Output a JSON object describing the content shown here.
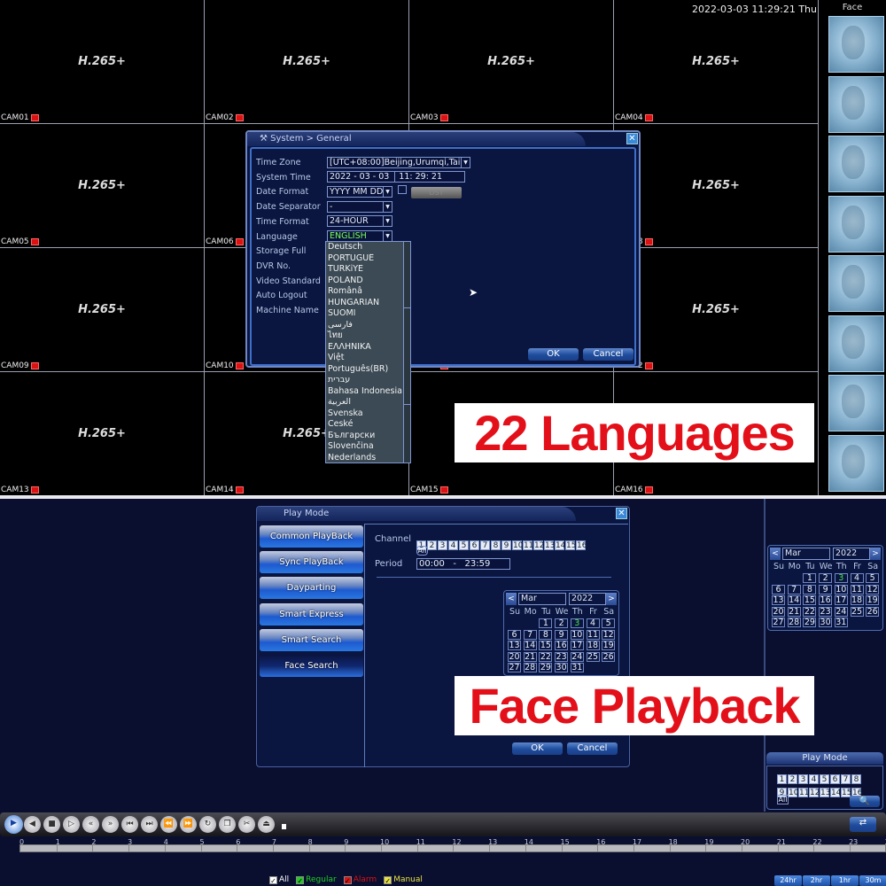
{
  "live": {
    "datetime": "2022-03-03 11:29:21 Thu",
    "codec": "H.265+",
    "cameras": [
      "CAM01",
      "CAM02",
      "CAM03",
      "CAM04",
      "CAM05",
      "CAM06",
      "CAM07",
      "CAM08",
      "CAM09",
      "CAM10",
      "CAM11",
      "CAM12",
      "CAM13",
      "CAM14",
      "CAM15",
      "CAM16"
    ],
    "face_panel_title": "Face",
    "face_count": 8
  },
  "general_dialog": {
    "title": "System > General",
    "close": "✕",
    "labels": [
      "Time Zone",
      "System Time",
      "Date Format",
      "Date Separator",
      "Time Format",
      "Language",
      "Storage Full",
      "DVR No.",
      "Video Standard",
      "Auto Logout",
      "Machine Name"
    ],
    "time_zone": "[UTC+08:00]Beijing,Urumqi,Tai",
    "system_date": "2022 - 03 - 03",
    "system_time": "11: 29: 21",
    "date_format": "YYYY MM DD",
    "dst_label": "DST",
    "date_separator": "-",
    "time_format": "24-HOUR",
    "language": "ENGLISH",
    "language_color": "#7dff5a",
    "ok": "OK",
    "cancel": "Cancel",
    "language_options": [
      "Deutsch",
      "PORTUGUÊ",
      "TÜRKiYE",
      "POLAND",
      "Românâ",
      "HUNGARIAN",
      "SUOMI",
      "فارسی",
      "ไทย",
      "ΕΛΛΗΝΙΚΑ",
      "Việt",
      "Português(BR)",
      "עברית",
      "Bahasa Indonesia",
      "العربية",
      "Svenska",
      "České",
      "Български",
      "Slovenčina",
      "Nederlands"
    ]
  },
  "banner_top": "22 Languages",
  "banner_bottom": "Face Playback",
  "play_dialog": {
    "title": "Play Mode",
    "close": "✕",
    "modes": [
      "Common PlayBack",
      "Sync PlayBack",
      "Dayparting",
      "Smart Express",
      "Smart Search",
      "Face Search"
    ],
    "selected_mode": "Face Search",
    "channel_label": "Channel",
    "channels": [
      "1",
      "2",
      "3",
      "4",
      "5",
      "6",
      "7",
      "8",
      "9",
      "10",
      "11",
      "12",
      "13",
      "14",
      "15",
      "16"
    ],
    "all_label": "All",
    "period_label": "Period",
    "period_start": "00:00",
    "period_sep": "-",
    "period_end": "23:59",
    "ok": "OK",
    "cancel": "Cancel"
  },
  "calendar": {
    "month": "Mar",
    "year": "2022",
    "prev": "<",
    "next": ">",
    "weekdays": [
      "Su",
      "Mo",
      "Tu",
      "We",
      "Th",
      "Fr",
      "Sa"
    ],
    "first_weekday": 2,
    "days_in_month": 31,
    "today": 3,
    "today_color": "#4ee04e"
  },
  "side_panel": {
    "title": "Play Mode",
    "channels": [
      "1",
      "2",
      "3",
      "4",
      "5",
      "6",
      "7",
      "8",
      "9",
      "10",
      "11",
      "12",
      "13",
      "14",
      "15",
      "16"
    ],
    "all_label": "All"
  },
  "toolbar": {
    "buttons": [
      "play",
      "slow-reverse",
      "stop",
      "step-forward",
      "fast-rewind",
      "fast-forward",
      "prev-frame",
      "next-frame",
      "prev-file",
      "next-file",
      "refresh",
      "fullscreen",
      "clip",
      "backup"
    ]
  },
  "timeline": {
    "hours": [
      "0",
      "1",
      "2",
      "3",
      "4",
      "5",
      "6",
      "7",
      "8",
      "9",
      "10",
      "11",
      "12",
      "13",
      "14",
      "15",
      "16",
      "17",
      "18",
      "19",
      "20",
      "21",
      "22",
      "23",
      "24"
    ],
    "filters": [
      {
        "label": "All",
        "color": "#ffffff"
      },
      {
        "label": "Regular",
        "color": "#22cc22"
      },
      {
        "label": "Alarm",
        "color": "#dd1111"
      },
      {
        "label": "Manual",
        "color": "#e8e040"
      }
    ],
    "ranges": [
      "24hr",
      "2hr",
      "1hr",
      "30m"
    ]
  }
}
